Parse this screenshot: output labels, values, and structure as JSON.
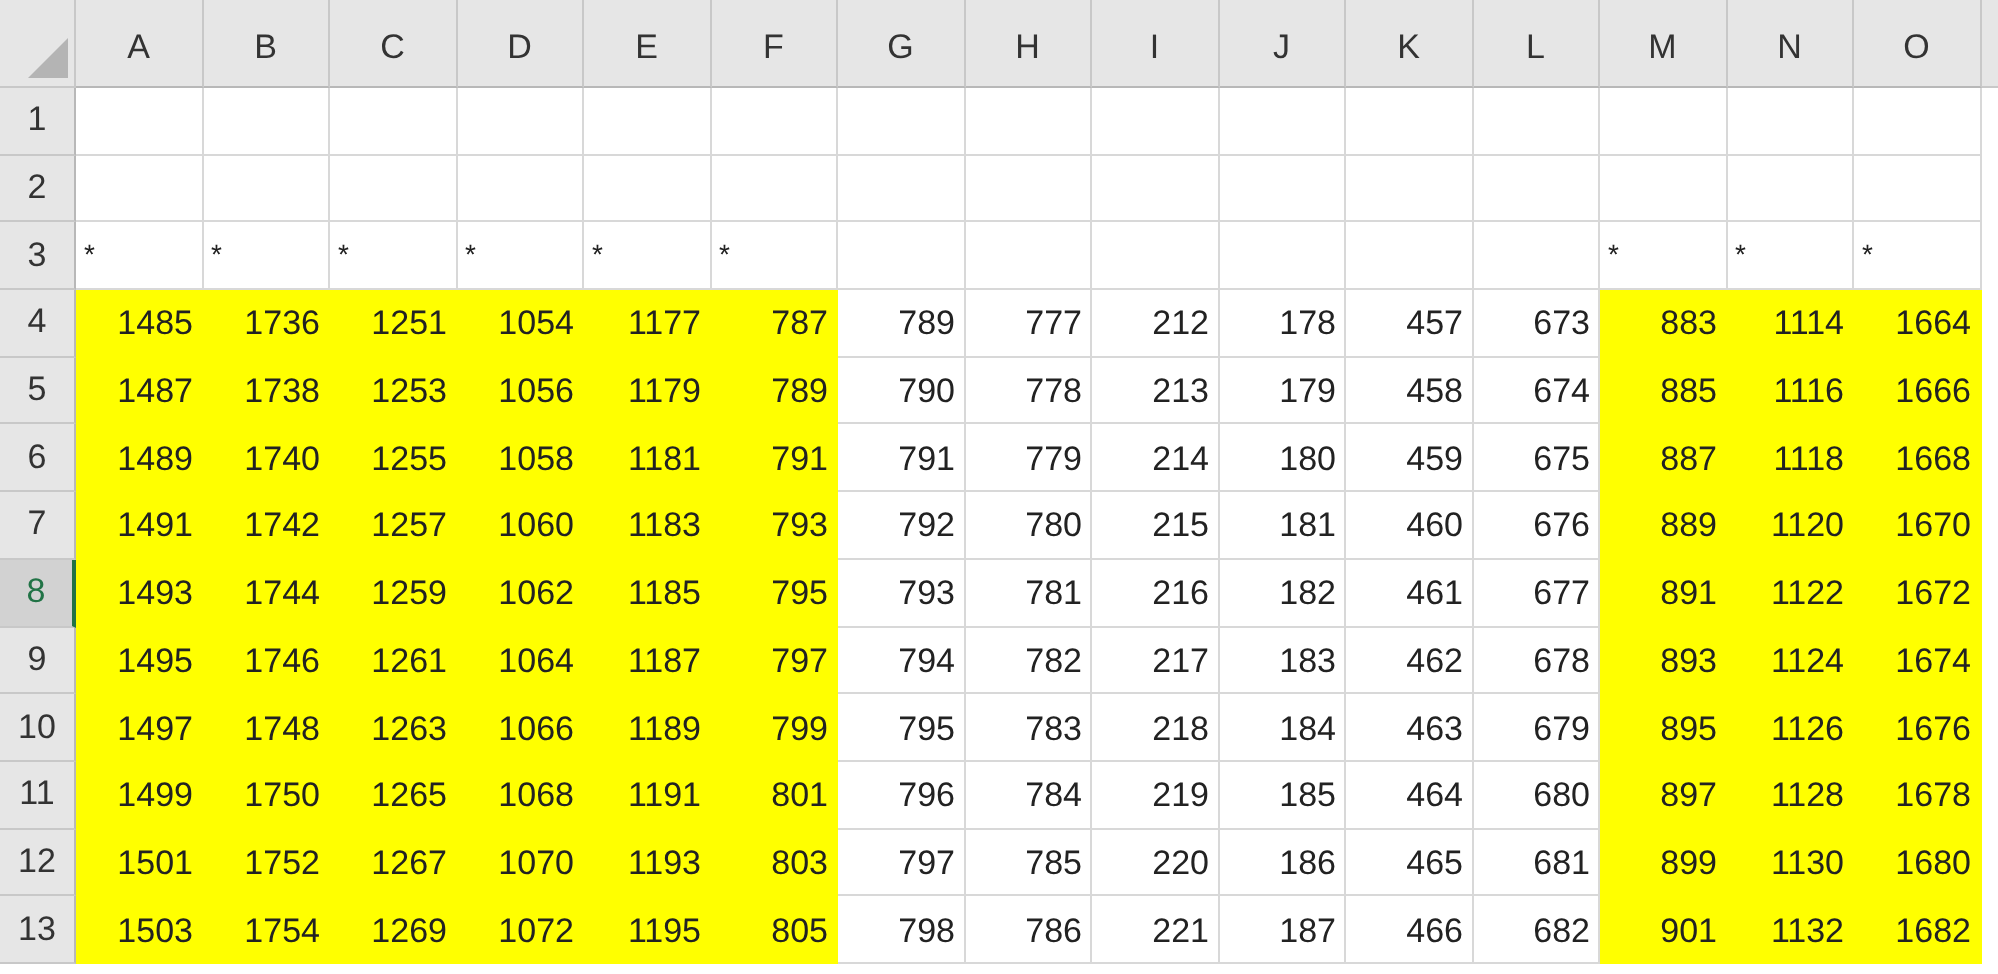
{
  "columns": [
    {
      "label": "A"
    },
    {
      "label": "B"
    },
    {
      "label": "C"
    },
    {
      "label": "D"
    },
    {
      "label": "E"
    },
    {
      "label": "F"
    },
    {
      "label": "G"
    },
    {
      "label": "H"
    },
    {
      "label": "I"
    },
    {
      "label": "J"
    },
    {
      "label": "K"
    },
    {
      "label": "L"
    },
    {
      "label": "M"
    },
    {
      "label": "N"
    },
    {
      "label": "O"
    }
  ],
  "rows": [
    {
      "label": "1",
      "selected": false,
      "cells": [
        {
          "kind": "empty",
          "highlighted": false
        },
        {
          "kind": "empty",
          "highlighted": false
        },
        {
          "kind": "empty",
          "highlighted": false
        },
        {
          "kind": "empty",
          "highlighted": false
        },
        {
          "kind": "empty",
          "highlighted": false
        },
        {
          "kind": "empty",
          "highlighted": false
        },
        {
          "kind": "empty",
          "highlighted": false
        },
        {
          "kind": "empty",
          "highlighted": false
        },
        {
          "kind": "empty",
          "highlighted": false
        },
        {
          "kind": "empty",
          "highlighted": false
        },
        {
          "kind": "empty",
          "highlighted": false
        },
        {
          "kind": "empty",
          "highlighted": false
        },
        {
          "kind": "empty",
          "highlighted": false
        },
        {
          "kind": "empty",
          "highlighted": false
        },
        {
          "kind": "empty",
          "highlighted": false
        }
      ]
    },
    {
      "label": "2",
      "selected": false,
      "cells": [
        {
          "kind": "empty",
          "highlighted": false
        },
        {
          "kind": "empty",
          "highlighted": false
        },
        {
          "kind": "empty",
          "highlighted": false
        },
        {
          "kind": "empty",
          "highlighted": false
        },
        {
          "kind": "empty",
          "highlighted": false
        },
        {
          "kind": "empty",
          "highlighted": false
        },
        {
          "kind": "empty",
          "highlighted": false
        },
        {
          "kind": "empty",
          "highlighted": false
        },
        {
          "kind": "empty",
          "highlighted": false
        },
        {
          "kind": "empty",
          "highlighted": false
        },
        {
          "kind": "empty",
          "highlighted": false
        },
        {
          "kind": "empty",
          "highlighted": false
        },
        {
          "kind": "empty",
          "highlighted": false
        },
        {
          "kind": "empty",
          "highlighted": false
        },
        {
          "kind": "empty",
          "highlighted": false
        }
      ]
    },
    {
      "label": "3",
      "selected": false,
      "cells": [
        {
          "kind": "text",
          "text": "*",
          "highlighted": false
        },
        {
          "kind": "text",
          "text": "*",
          "highlighted": false
        },
        {
          "kind": "text",
          "text": "*",
          "highlighted": false
        },
        {
          "kind": "text",
          "text": "*",
          "highlighted": false
        },
        {
          "kind": "text",
          "text": "*",
          "highlighted": false
        },
        {
          "kind": "text",
          "text": "*",
          "highlighted": false
        },
        {
          "kind": "empty",
          "highlighted": false
        },
        {
          "kind": "empty",
          "highlighted": false
        },
        {
          "kind": "empty",
          "highlighted": false
        },
        {
          "kind": "empty",
          "highlighted": false
        },
        {
          "kind": "empty",
          "highlighted": false
        },
        {
          "kind": "empty",
          "highlighted": false
        },
        {
          "kind": "text",
          "text": "*",
          "highlighted": false
        },
        {
          "kind": "text",
          "text": "*",
          "highlighted": false
        },
        {
          "kind": "text",
          "text": "*",
          "highlighted": false
        }
      ]
    },
    {
      "label": "4",
      "selected": false,
      "cells": [
        {
          "kind": "number",
          "text": "1485",
          "highlighted": true
        },
        {
          "kind": "number",
          "text": "1736",
          "highlighted": true
        },
        {
          "kind": "number",
          "text": "1251",
          "highlighted": true
        },
        {
          "kind": "number",
          "text": "1054",
          "highlighted": true
        },
        {
          "kind": "number",
          "text": "1177",
          "highlighted": true
        },
        {
          "kind": "number",
          "text": "787",
          "highlighted": true
        },
        {
          "kind": "number",
          "text": "789",
          "highlighted": false
        },
        {
          "kind": "number",
          "text": "777",
          "highlighted": false
        },
        {
          "kind": "number",
          "text": "212",
          "highlighted": false
        },
        {
          "kind": "number",
          "text": "178",
          "highlighted": false
        },
        {
          "kind": "number",
          "text": "457",
          "highlighted": false
        },
        {
          "kind": "number",
          "text": "673",
          "highlighted": false
        },
        {
          "kind": "number",
          "text": "883",
          "highlighted": true
        },
        {
          "kind": "number",
          "text": "1114",
          "highlighted": true
        },
        {
          "kind": "number",
          "text": "1664",
          "highlighted": true
        }
      ]
    },
    {
      "label": "5",
      "selected": false,
      "cells": [
        {
          "kind": "number",
          "text": "1487",
          "highlighted": true
        },
        {
          "kind": "number",
          "text": "1738",
          "highlighted": true
        },
        {
          "kind": "number",
          "text": "1253",
          "highlighted": true
        },
        {
          "kind": "number",
          "text": "1056",
          "highlighted": true
        },
        {
          "kind": "number",
          "text": "1179",
          "highlighted": true
        },
        {
          "kind": "number",
          "text": "789",
          "highlighted": true
        },
        {
          "kind": "number",
          "text": "790",
          "highlighted": false
        },
        {
          "kind": "number",
          "text": "778",
          "highlighted": false
        },
        {
          "kind": "number",
          "text": "213",
          "highlighted": false
        },
        {
          "kind": "number",
          "text": "179",
          "highlighted": false
        },
        {
          "kind": "number",
          "text": "458",
          "highlighted": false
        },
        {
          "kind": "number",
          "text": "674",
          "highlighted": false
        },
        {
          "kind": "number",
          "text": "885",
          "highlighted": true
        },
        {
          "kind": "number",
          "text": "1116",
          "highlighted": true
        },
        {
          "kind": "number",
          "text": "1666",
          "highlighted": true
        }
      ]
    },
    {
      "label": "6",
      "selected": false,
      "cells": [
        {
          "kind": "number",
          "text": "1489",
          "highlighted": true
        },
        {
          "kind": "number",
          "text": "1740",
          "highlighted": true
        },
        {
          "kind": "number",
          "text": "1255",
          "highlighted": true
        },
        {
          "kind": "number",
          "text": "1058",
          "highlighted": true
        },
        {
          "kind": "number",
          "text": "1181",
          "highlighted": true
        },
        {
          "kind": "number",
          "text": "791",
          "highlighted": true
        },
        {
          "kind": "number",
          "text": "791",
          "highlighted": false
        },
        {
          "kind": "number",
          "text": "779",
          "highlighted": false
        },
        {
          "kind": "number",
          "text": "214",
          "highlighted": false
        },
        {
          "kind": "number",
          "text": "180",
          "highlighted": false
        },
        {
          "kind": "number",
          "text": "459",
          "highlighted": false
        },
        {
          "kind": "number",
          "text": "675",
          "highlighted": false
        },
        {
          "kind": "number",
          "text": "887",
          "highlighted": true
        },
        {
          "kind": "number",
          "text": "1118",
          "highlighted": true
        },
        {
          "kind": "number",
          "text": "1668",
          "highlighted": true
        }
      ]
    },
    {
      "label": "7",
      "selected": false,
      "cells": [
        {
          "kind": "number",
          "text": "1491",
          "highlighted": true
        },
        {
          "kind": "number",
          "text": "1742",
          "highlighted": true
        },
        {
          "kind": "number",
          "text": "1257",
          "highlighted": true
        },
        {
          "kind": "number",
          "text": "1060",
          "highlighted": true
        },
        {
          "kind": "number",
          "text": "1183",
          "highlighted": true
        },
        {
          "kind": "number",
          "text": "793",
          "highlighted": true
        },
        {
          "kind": "number",
          "text": "792",
          "highlighted": false
        },
        {
          "kind": "number",
          "text": "780",
          "highlighted": false
        },
        {
          "kind": "number",
          "text": "215",
          "highlighted": false
        },
        {
          "kind": "number",
          "text": "181",
          "highlighted": false
        },
        {
          "kind": "number",
          "text": "460",
          "highlighted": false
        },
        {
          "kind": "number",
          "text": "676",
          "highlighted": false
        },
        {
          "kind": "number",
          "text": "889",
          "highlighted": true
        },
        {
          "kind": "number",
          "text": "1120",
          "highlighted": true
        },
        {
          "kind": "number",
          "text": "1670",
          "highlighted": true
        }
      ]
    },
    {
      "label": "8",
      "selected": true,
      "cells": [
        {
          "kind": "number",
          "text": "1493",
          "highlighted": true
        },
        {
          "kind": "number",
          "text": "1744",
          "highlighted": true
        },
        {
          "kind": "number",
          "text": "1259",
          "highlighted": true
        },
        {
          "kind": "number",
          "text": "1062",
          "highlighted": true
        },
        {
          "kind": "number",
          "text": "1185",
          "highlighted": true
        },
        {
          "kind": "number",
          "text": "795",
          "highlighted": true
        },
        {
          "kind": "number",
          "text": "793",
          "highlighted": false
        },
        {
          "kind": "number",
          "text": "781",
          "highlighted": false
        },
        {
          "kind": "number",
          "text": "216",
          "highlighted": false
        },
        {
          "kind": "number",
          "text": "182",
          "highlighted": false
        },
        {
          "kind": "number",
          "text": "461",
          "highlighted": false
        },
        {
          "kind": "number",
          "text": "677",
          "highlighted": false
        },
        {
          "kind": "number",
          "text": "891",
          "highlighted": true
        },
        {
          "kind": "number",
          "text": "1122",
          "highlighted": true
        },
        {
          "kind": "number",
          "text": "1672",
          "highlighted": true
        }
      ]
    },
    {
      "label": "9",
      "selected": false,
      "cells": [
        {
          "kind": "number",
          "text": "1495",
          "highlighted": true
        },
        {
          "kind": "number",
          "text": "1746",
          "highlighted": true
        },
        {
          "kind": "number",
          "text": "1261",
          "highlighted": true
        },
        {
          "kind": "number",
          "text": "1064",
          "highlighted": true
        },
        {
          "kind": "number",
          "text": "1187",
          "highlighted": true
        },
        {
          "kind": "number",
          "text": "797",
          "highlighted": true
        },
        {
          "kind": "number",
          "text": "794",
          "highlighted": false
        },
        {
          "kind": "number",
          "text": "782",
          "highlighted": false
        },
        {
          "kind": "number",
          "text": "217",
          "highlighted": false
        },
        {
          "kind": "number",
          "text": "183",
          "highlighted": false
        },
        {
          "kind": "number",
          "text": "462",
          "highlighted": false
        },
        {
          "kind": "number",
          "text": "678",
          "highlighted": false
        },
        {
          "kind": "number",
          "text": "893",
          "highlighted": true
        },
        {
          "kind": "number",
          "text": "1124",
          "highlighted": true
        },
        {
          "kind": "number",
          "text": "1674",
          "highlighted": true
        }
      ]
    },
    {
      "label": "10",
      "selected": false,
      "cells": [
        {
          "kind": "number",
          "text": "1497",
          "highlighted": true
        },
        {
          "kind": "number",
          "text": "1748",
          "highlighted": true
        },
        {
          "kind": "number",
          "text": "1263",
          "highlighted": true
        },
        {
          "kind": "number",
          "text": "1066",
          "highlighted": true
        },
        {
          "kind": "number",
          "text": "1189",
          "highlighted": true
        },
        {
          "kind": "number",
          "text": "799",
          "highlighted": true
        },
        {
          "kind": "number",
          "text": "795",
          "highlighted": false
        },
        {
          "kind": "number",
          "text": "783",
          "highlighted": false
        },
        {
          "kind": "number",
          "text": "218",
          "highlighted": false
        },
        {
          "kind": "number",
          "text": "184",
          "highlighted": false
        },
        {
          "kind": "number",
          "text": "463",
          "highlighted": false
        },
        {
          "kind": "number",
          "text": "679",
          "highlighted": false
        },
        {
          "kind": "number",
          "text": "895",
          "highlighted": true
        },
        {
          "kind": "number",
          "text": "1126",
          "highlighted": true
        },
        {
          "kind": "number",
          "text": "1676",
          "highlighted": true
        }
      ]
    },
    {
      "label": "11",
      "selected": false,
      "cells": [
        {
          "kind": "number",
          "text": "1499",
          "highlighted": true
        },
        {
          "kind": "number",
          "text": "1750",
          "highlighted": true
        },
        {
          "kind": "number",
          "text": "1265",
          "highlighted": true
        },
        {
          "kind": "number",
          "text": "1068",
          "highlighted": true
        },
        {
          "kind": "number",
          "text": "1191",
          "highlighted": true
        },
        {
          "kind": "number",
          "text": "801",
          "highlighted": true
        },
        {
          "kind": "number",
          "text": "796",
          "highlighted": false
        },
        {
          "kind": "number",
          "text": "784",
          "highlighted": false
        },
        {
          "kind": "number",
          "text": "219",
          "highlighted": false
        },
        {
          "kind": "number",
          "text": "185",
          "highlighted": false
        },
        {
          "kind": "number",
          "text": "464",
          "highlighted": false
        },
        {
          "kind": "number",
          "text": "680",
          "highlighted": false
        },
        {
          "kind": "number",
          "text": "897",
          "highlighted": true
        },
        {
          "kind": "number",
          "text": "1128",
          "highlighted": true
        },
        {
          "kind": "number",
          "text": "1678",
          "highlighted": true
        }
      ]
    },
    {
      "label": "12",
      "selected": false,
      "cells": [
        {
          "kind": "number",
          "text": "1501",
          "highlighted": true
        },
        {
          "kind": "number",
          "text": "1752",
          "highlighted": true
        },
        {
          "kind": "number",
          "text": "1267",
          "highlighted": true
        },
        {
          "kind": "number",
          "text": "1070",
          "highlighted": true
        },
        {
          "kind": "number",
          "text": "1193",
          "highlighted": true
        },
        {
          "kind": "number",
          "text": "803",
          "highlighted": true
        },
        {
          "kind": "number",
          "text": "797",
          "highlighted": false
        },
        {
          "kind": "number",
          "text": "785",
          "highlighted": false
        },
        {
          "kind": "number",
          "text": "220",
          "highlighted": false
        },
        {
          "kind": "number",
          "text": "186",
          "highlighted": false
        },
        {
          "kind": "number",
          "text": "465",
          "highlighted": false
        },
        {
          "kind": "number",
          "text": "681",
          "highlighted": false
        },
        {
          "kind": "number",
          "text": "899",
          "highlighted": true
        },
        {
          "kind": "number",
          "text": "1130",
          "highlighted": true
        },
        {
          "kind": "number",
          "text": "1680",
          "highlighted": true
        }
      ]
    },
    {
      "label": "13",
      "selected": false,
      "cells": [
        {
          "kind": "number",
          "text": "1503",
          "highlighted": true
        },
        {
          "kind": "number",
          "text": "1754",
          "highlighted": true
        },
        {
          "kind": "number",
          "text": "1269",
          "highlighted": true
        },
        {
          "kind": "number",
          "text": "1072",
          "highlighted": true
        },
        {
          "kind": "number",
          "text": "1195",
          "highlighted": true
        },
        {
          "kind": "number",
          "text": "805",
          "highlighted": true
        },
        {
          "kind": "number",
          "text": "798",
          "highlighted": false
        },
        {
          "kind": "number",
          "text": "786",
          "highlighted": false
        },
        {
          "kind": "number",
          "text": "221",
          "highlighted": false
        },
        {
          "kind": "number",
          "text": "187",
          "highlighted": false
        },
        {
          "kind": "number",
          "text": "466",
          "highlighted": false
        },
        {
          "kind": "number",
          "text": "682",
          "highlighted": false
        },
        {
          "kind": "number",
          "text": "901",
          "highlighted": true
        },
        {
          "kind": "number",
          "text": "1132",
          "highlighted": true
        },
        {
          "kind": "number",
          "text": "1682",
          "highlighted": true
        }
      ]
    }
  ]
}
